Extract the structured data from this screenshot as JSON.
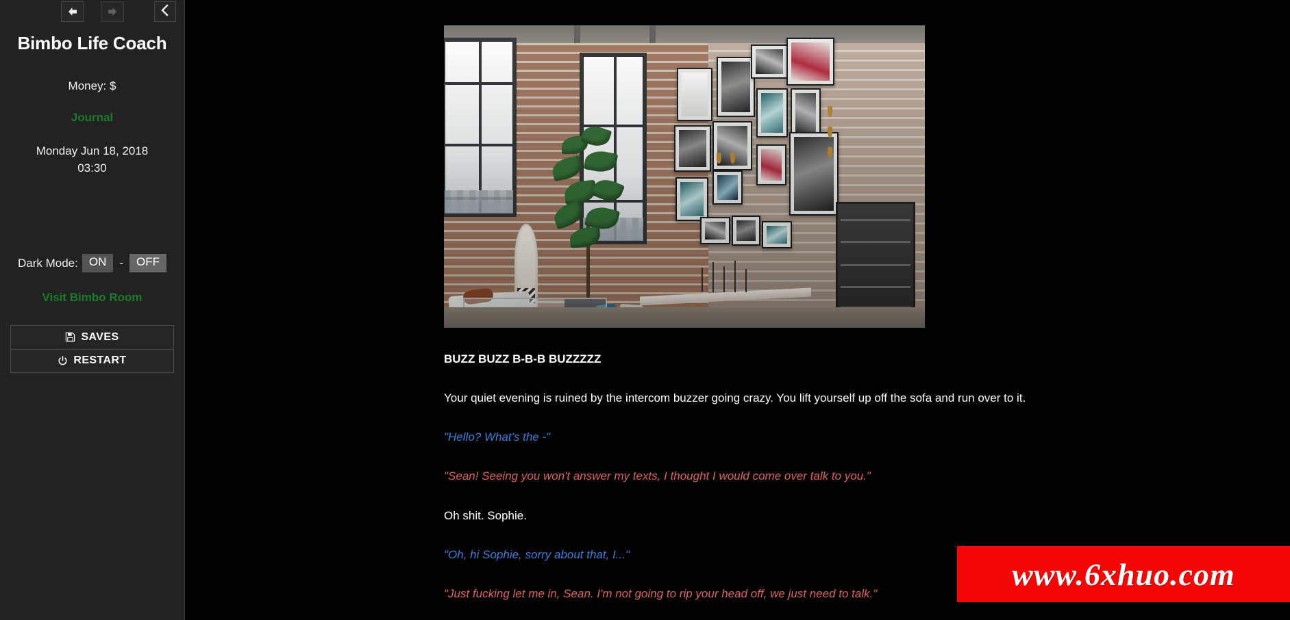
{
  "sidebar": {
    "nav": {
      "back_icon": "arrow-left-icon",
      "forward_icon": "arrow-right-icon",
      "collapse_icon": "chevron-left-icon"
    },
    "title": "Bimbo Life Coach",
    "money_label": "Money: $",
    "journal_link": "Journal",
    "date": "Monday Jun 18, 2018",
    "time": "03:30",
    "dark_mode": {
      "label": "Dark Mode:",
      "on_label": "ON",
      "separator": "-",
      "off_label": "OFF",
      "selected": "ON"
    },
    "visit_room_link": "Visit Bimbo Room",
    "buttons": [
      {
        "label": "SAVES",
        "icon": "floppy-disk-icon"
      },
      {
        "label": "RESTART",
        "icon": "power-icon"
      }
    ]
  },
  "main": {
    "scene_alt": "loft-interior-photo",
    "story": [
      {
        "style": "head",
        "text": "BUZZ BUZZ B-B-B BUZZZZZ"
      },
      {
        "style": "plain",
        "text": "Your quiet evening is ruined by the intercom buzzer going crazy. You lift yourself up off the sofa and run over to it."
      },
      {
        "style": "player",
        "text": "\"Hello? What's the -\""
      },
      {
        "style": "sophie",
        "text": "\"Sean! Seeing you won't answer my texts, I thought I would come over talk to you.\""
      },
      {
        "style": "plain",
        "text": "Oh shit. Sophie."
      },
      {
        "style": "player",
        "text": "\"Oh, hi Sophie, sorry about that, I...\""
      },
      {
        "style": "sophie",
        "text": "\"Just fucking let me in, Sean. I'm not going to rip your head off, we just need to talk.\""
      }
    ]
  },
  "watermark": {
    "text": "www.6xhuo.com",
    "background": "#f30707",
    "color": "#ffffff"
  },
  "colors": {
    "sidebar_bg": "#222222",
    "main_bg": "#000000",
    "link_green": "#1b7a2a",
    "player_blue": "#3b7fe0",
    "sophie_red": "#e0625c"
  }
}
